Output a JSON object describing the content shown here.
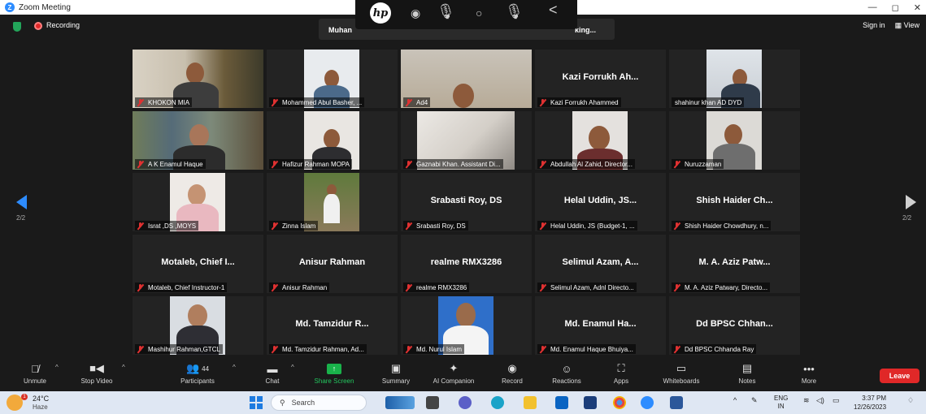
{
  "window": {
    "title": "Zoom Meeting",
    "controls": [
      "—",
      "◻",
      "✕"
    ]
  },
  "topbar": {
    "recording_label": "Recording",
    "speaking_left": "Muhan",
    "speaking_right": "king...",
    "sign_in": "Sign in",
    "view_label": "View",
    "view_icon": "grid-icon"
  },
  "hp_bar": {
    "logo": "hp"
  },
  "gallery": {
    "page_left": "2/2",
    "page_right": "2/2",
    "tiles": [
      {
        "label": "KHOKON MIA",
        "muted": true,
        "video": true
      },
      {
        "label": "Mohammed Abul Basher, ...",
        "muted": true,
        "video": true
      },
      {
        "label": "Ad4",
        "muted": true,
        "video": true
      },
      {
        "big": "Kazi Forrukh Ah...",
        "label": "Kazi Forrukh Ahammed",
        "muted": true,
        "video": false
      },
      {
        "label": "shahinur khan AD DYD",
        "muted": false,
        "video": true
      },
      {
        "label": "A K Enamul Haque",
        "muted": true,
        "video": true
      },
      {
        "label": "Hafizur Rahman MOPA",
        "muted": true,
        "video": true
      },
      {
        "label": "Gaznabi Khan. Assistant Di...",
        "muted": true,
        "video": true
      },
      {
        "label": "Abdullah Al Zahid, Director...",
        "muted": true,
        "video": true
      },
      {
        "label": "Nuruzzaman",
        "muted": true,
        "video": true
      },
      {
        "label": "Israt ,DS ,MOYS",
        "muted": true,
        "video": true
      },
      {
        "label": "Zinna Islam",
        "muted": true,
        "video": true
      },
      {
        "big": "Srabasti Roy, DS",
        "label": "Srabasti Roy, DS",
        "muted": true,
        "video": false
      },
      {
        "big": "Helal Uddin, JS...",
        "label": "Helal Uddin, JS (Budget-1, ...",
        "muted": true,
        "video": false
      },
      {
        "big": "Shish Haider Ch...",
        "label": "Shish Haider Chowdhury, n...",
        "muted": true,
        "video": false
      },
      {
        "big": "Motaleb, Chief I...",
        "label": "Motaleb, Chief Instructor-1",
        "muted": true,
        "video": false
      },
      {
        "big": "Anisur Rahman",
        "label": "Anisur Rahman",
        "muted": true,
        "video": false
      },
      {
        "big": "realme RMX3286",
        "label": "realme RMX3286",
        "muted": true,
        "video": false
      },
      {
        "big": "Selimul Azam, A...",
        "label": "Selimul Azam, Adnl Directo...",
        "muted": true,
        "video": false
      },
      {
        "big": "M. A. Aziz Patw...",
        "label": "M. A. Aziz Patwary, Directo...",
        "muted": true,
        "video": false
      },
      {
        "label": "Mashihur Rahman,GTCL",
        "muted": true,
        "video": true
      },
      {
        "big": "Md. Tamzidur R...",
        "label": "Md. Tamzidur Rahman, Ad...",
        "muted": true,
        "video": false
      },
      {
        "label": "Md. Nurul Islam",
        "muted": true,
        "video": true
      },
      {
        "big": "Md. Enamul Ha...",
        "label": "Md. Enamul Haque Bhuiya...",
        "muted": true,
        "video": false
      },
      {
        "big": "Dd BPSC Chhan...",
        "label": "Dd BPSC Chhanda Ray",
        "muted": true,
        "video": false
      }
    ]
  },
  "toolbar": {
    "unmute": "Unmute",
    "stop_video": "Stop Video",
    "participants": "Participants",
    "participant_count": "44",
    "chat": "Chat",
    "share_screen": "Share Screen",
    "summary": "Summary",
    "ai_companion": "AI Companion",
    "record": "Record",
    "reactions": "Reactions",
    "apps": "Apps",
    "whiteboards": "Whiteboards",
    "notes": "Notes",
    "more": "More",
    "leave": "Leave"
  },
  "taskbar": {
    "temperature": "24°C",
    "condition": "Haze",
    "weather_badge": "1",
    "search_placeholder": "Search",
    "lang_top": "ENG",
    "lang_bottom": "IN",
    "time": "3:37 PM",
    "date": "12/26/2023"
  },
  "colors": {
    "accent": "#2d8cff",
    "leave": "#e02828",
    "share": "#19b24a",
    "mute": "#e03131"
  }
}
